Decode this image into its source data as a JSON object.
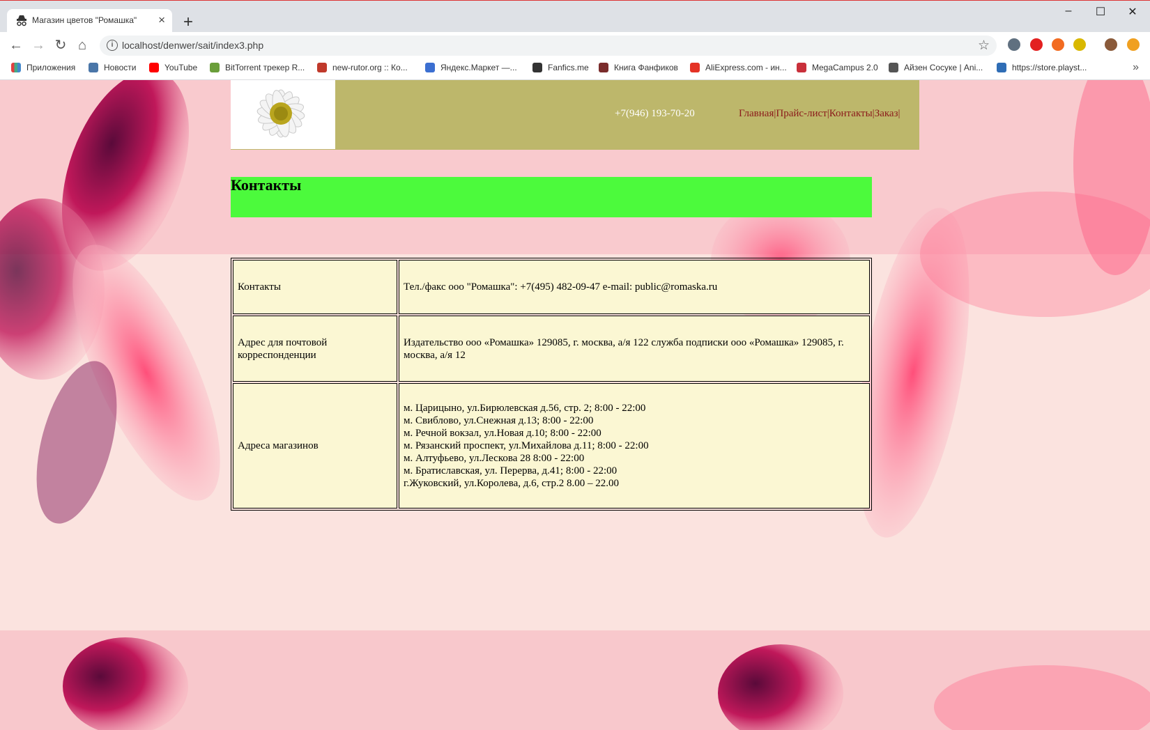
{
  "browser": {
    "tab_title": "Магазин цветов \"Ромашка\"",
    "url": "localhost/denwer/sait/index3.php",
    "bookmarks": [
      {
        "label": "Приложения",
        "color": "#e04040"
      },
      {
        "label": "Новости",
        "color": "#4a76a8"
      },
      {
        "label": "YouTube",
        "color": "#ff0000"
      },
      {
        "label": "BitTorrent трекер R...",
        "color": "#6a9e3a"
      },
      {
        "label": "new-rutor.org :: Ко...",
        "color": "#c0392b"
      },
      {
        "label": "Яндекс.Маркет —...",
        "color": "#3b6fd1"
      },
      {
        "label": "Fanfics.me",
        "color": "#333333"
      },
      {
        "label": "Книга Фанфиков",
        "color": "#7a2c2c"
      },
      {
        "label": "AliExpress.com - ин...",
        "color": "#e43225"
      },
      {
        "label": "MegaCampus 2.0",
        "color": "#c9303b"
      },
      {
        "label": "Айзен Сосуке | Ani...",
        "color": "#555555"
      },
      {
        "label": "https://store.playst...",
        "color": "#2f6db5"
      }
    ]
  },
  "page": {
    "phone": "+7(946) 193-70-20",
    "menu": [
      "Главная|",
      "Прайс-лист|",
      "Контакты|",
      "Заказ|"
    ],
    "heading": "Контакты",
    "table": {
      "rows": [
        {
          "label": "Контакты",
          "value_lines": [
            "Тел./факс ооо \"Ромашка\": +7(495) 482-09-47 e-mail: public@romaska.ru"
          ]
        },
        {
          "label": "Адрес для почтовой корреспонденции",
          "value_lines": [
            "Издательство ооо «Ромашка» 129085, г. москва, а/я 122 служба подписки ооо «Ромашка» 129085, г. москва, а/я 12"
          ]
        },
        {
          "label": "Адреса магазинов",
          "value_lines": [
            "м. Царицыно, ул.Бирюлевская д.56, стр. 2; 8:00 - 22:00",
            "м. Свиблово, ул.Снежная д.13; 8:00 - 22:00",
            "м. Речной вокзал, ул.Новая д.10; 8:00 - 22:00",
            "м. Рязанский проспект, ул.Михайлова д.11; 8:00 - 22:00",
            "м. Алтуфьево, ул.Лескова 28 8:00 - 22:00",
            "м. Братиславская, ул. Перерва, д.41; 8:00 - 22:00",
            "г.Жуковский, ул.Королева, д.6, стр.2 8.00 – 22.00"
          ]
        }
      ]
    }
  }
}
